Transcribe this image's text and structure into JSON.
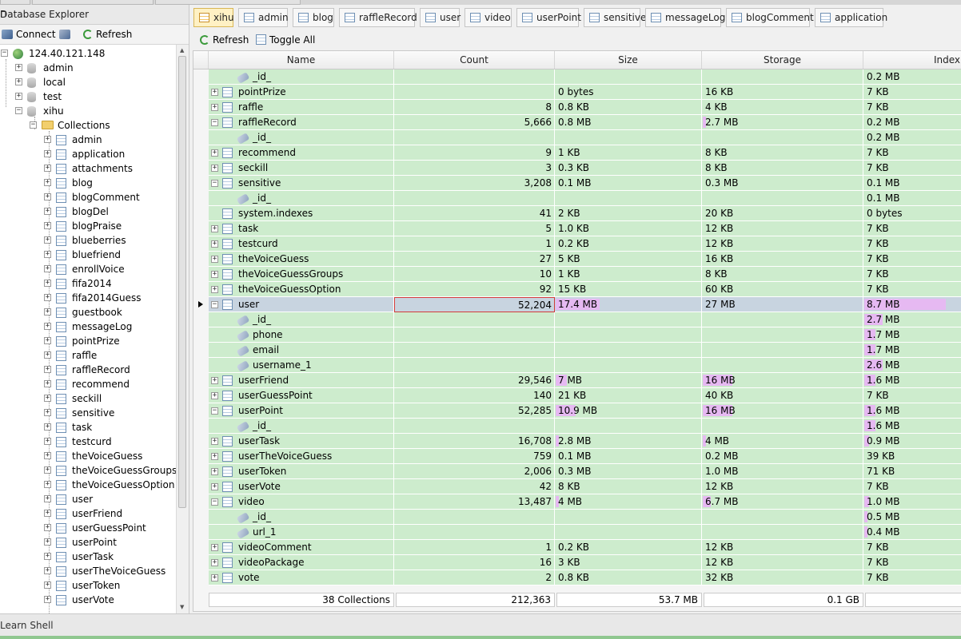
{
  "explorer": {
    "title": "Database Explorer",
    "connect_label": "Connect",
    "refresh_label": "Refresh",
    "server": "124.40.121.148",
    "databases": [
      "admin",
      "local",
      "test",
      "xihu"
    ],
    "collections_folder": "Collections",
    "collections": [
      "admin",
      "application",
      "attachments",
      "blog",
      "blogComment",
      "blogDel",
      "blogPraise",
      "blueberries",
      "bluefriend",
      "enrollVoice",
      "fifa2014",
      "fifa2014Guess",
      "guestbook",
      "messageLog",
      "pointPrize",
      "raffle",
      "raffleRecord",
      "recommend",
      "seckill",
      "sensitive",
      "task",
      "testcurd",
      "theVoiceGuess",
      "theVoiceGuessGroups",
      "theVoiceGuessOption",
      "user",
      "userFriend",
      "userGuessPoint",
      "userPoint",
      "userTask",
      "userTheVoiceGuess",
      "userToken",
      "userVote"
    ]
  },
  "tabs": [
    "xihu",
    "admin",
    "blog",
    "raffleRecord",
    "user",
    "video",
    "userPoint",
    "sensitive",
    "messageLog",
    "blogComment",
    "application"
  ],
  "toolbar": {
    "refresh_label": "Refresh",
    "toggle_label": "Toggle All"
  },
  "grid": {
    "headers": {
      "name": "Name",
      "count": "Count",
      "size": "Size",
      "storage": "Storage",
      "index": "Index"
    },
    "rows": [
      {
        "type": "index",
        "name": "_id_",
        "count": "",
        "size": "",
        "storage": "",
        "index": "0.2 MB",
        "bars": {
          "size": 0,
          "storage": 0,
          "index": 0
        }
      },
      {
        "type": "coll",
        "exp": "+",
        "name": "pointPrize",
        "count": "",
        "size": "0 bytes",
        "storage": "16 KB",
        "index": "7 KB",
        "bars": {
          "size": 0,
          "storage": 0,
          "index": 0
        }
      },
      {
        "type": "coll",
        "exp": "+",
        "name": "raffle",
        "count": "8",
        "size": "0.8 KB",
        "storage": "4 KB",
        "index": "7 KB",
        "bars": {
          "size": 0,
          "storage": 0,
          "index": 0
        }
      },
      {
        "type": "coll",
        "exp": "-",
        "name": "raffleRecord",
        "count": "5,666",
        "size": "0.8 MB",
        "storage": "2.7 MB",
        "index": "0.2 MB",
        "bars": {
          "size": 0,
          "storage": 0.02,
          "index": 0
        }
      },
      {
        "type": "index",
        "name": "_id_",
        "count": "",
        "size": "",
        "storage": "",
        "index": "0.2 MB",
        "bars": {
          "size": 0,
          "storage": 0,
          "index": 0
        }
      },
      {
        "type": "coll",
        "exp": "+",
        "name": "recommend",
        "count": "9",
        "size": "1 KB",
        "storage": "8 KB",
        "index": "7 KB",
        "bars": {
          "size": 0,
          "storage": 0,
          "index": 0
        }
      },
      {
        "type": "coll",
        "exp": "+",
        "name": "seckill",
        "count": "3",
        "size": "0.3 KB",
        "storage": "8 KB",
        "index": "7 KB",
        "bars": {
          "size": 0,
          "storage": 0,
          "index": 0
        }
      },
      {
        "type": "coll",
        "exp": "-",
        "name": "sensitive",
        "count": "3,208",
        "size": "0.1 MB",
        "storage": "0.3 MB",
        "index": "0.1 MB",
        "bars": {
          "size": 0,
          "storage": 0,
          "index": 0
        }
      },
      {
        "type": "index",
        "name": "_id_",
        "count": "",
        "size": "",
        "storage": "",
        "index": "0.1 MB",
        "bars": {
          "size": 0,
          "storage": 0,
          "index": 0
        }
      },
      {
        "type": "coll",
        "exp": "",
        "name": "system.indexes",
        "count": "41",
        "size": "2 KB",
        "storage": "20 KB",
        "index": "0 bytes",
        "bars": {
          "size": 0,
          "storage": 0,
          "index": 0
        }
      },
      {
        "type": "coll",
        "exp": "+",
        "name": "task",
        "count": "5",
        "size": "1.0 KB",
        "storage": "12 KB",
        "index": "7 KB",
        "bars": {
          "size": 0,
          "storage": 0,
          "index": 0
        }
      },
      {
        "type": "coll",
        "exp": "+",
        "name": "testcurd",
        "count": "1",
        "size": "0.2 KB",
        "storage": "12 KB",
        "index": "7 KB",
        "bars": {
          "size": 0,
          "storage": 0,
          "index": 0
        }
      },
      {
        "type": "coll",
        "exp": "+",
        "name": "theVoiceGuess",
        "count": "27",
        "size": "5 KB",
        "storage": "16 KB",
        "index": "7 KB",
        "bars": {
          "size": 0,
          "storage": 0,
          "index": 0
        }
      },
      {
        "type": "coll",
        "exp": "+",
        "name": "theVoiceGuessGroups",
        "count": "10",
        "size": "1 KB",
        "storage": "8 KB",
        "index": "7 KB",
        "bars": {
          "size": 0,
          "storage": 0,
          "index": 0
        }
      },
      {
        "type": "coll",
        "exp": "+",
        "name": "theVoiceGuessOption",
        "count": "92",
        "size": "15 KB",
        "storage": "60 KB",
        "index": "7 KB",
        "bars": {
          "size": 0,
          "storage": 0,
          "index": 0
        }
      },
      {
        "type": "coll",
        "exp": "-",
        "name": "user",
        "count": "52,204",
        "size": "17.4 MB",
        "storage": "27 MB",
        "index": "8.7 MB",
        "selected": true,
        "bars": {
          "size": 0.31,
          "storage": 0,
          "index": 0.87
        }
      },
      {
        "type": "index",
        "name": "_id_",
        "count": "",
        "size": "",
        "storage": "",
        "index": "2.7 MB",
        "bars": {
          "size": 0,
          "storage": 0,
          "index": 0.2
        }
      },
      {
        "type": "index",
        "name": "phone",
        "count": "",
        "size": "",
        "storage": "",
        "index": "1.7 MB",
        "bars": {
          "size": 0,
          "storage": 0,
          "index": 0.12
        }
      },
      {
        "type": "index",
        "name": "email",
        "count": "",
        "size": "",
        "storage": "",
        "index": "1.7 MB",
        "bars": {
          "size": 0,
          "storage": 0,
          "index": 0.12
        }
      },
      {
        "type": "index",
        "name": "username_1",
        "count": "",
        "size": "",
        "storage": "",
        "index": "2.6 MB",
        "bars": {
          "size": 0,
          "storage": 0,
          "index": 0.2
        }
      },
      {
        "type": "coll",
        "exp": "+",
        "name": "userFriend",
        "count": "29,546",
        "size": "7 MB",
        "storage": "16 MB",
        "index": "1.6 MB",
        "bars": {
          "size": 0.08,
          "storage": 0.19,
          "index": 0.12
        }
      },
      {
        "type": "coll",
        "exp": "+",
        "name": "userGuessPoint",
        "count": "140",
        "size": "21 KB",
        "storage": "40 KB",
        "index": "7 KB",
        "bars": {
          "size": 0,
          "storage": 0,
          "index": 0
        }
      },
      {
        "type": "coll",
        "exp": "-",
        "name": "userPoint",
        "count": "52,285",
        "size": "10.9 MB",
        "storage": "16 MB",
        "index": "1.6 MB",
        "bars": {
          "size": 0.14,
          "storage": 0.19,
          "index": 0.12
        }
      },
      {
        "type": "index",
        "name": "_id_",
        "count": "",
        "size": "",
        "storage": "",
        "index": "1.6 MB",
        "bars": {
          "size": 0,
          "storage": 0,
          "index": 0.12
        }
      },
      {
        "type": "coll",
        "exp": "+",
        "name": "userTask",
        "count": "16,708",
        "size": "2.8 MB",
        "storage": "4 MB",
        "index": "0.9 MB",
        "bars": {
          "size": 0.02,
          "storage": 0.02,
          "index": 0.05
        }
      },
      {
        "type": "coll",
        "exp": "+",
        "name": "userTheVoiceGuess",
        "count": "759",
        "size": "0.1 MB",
        "storage": "0.2 MB",
        "index": "39 KB",
        "bars": {
          "size": 0,
          "storage": 0,
          "index": 0
        }
      },
      {
        "type": "coll",
        "exp": "+",
        "name": "userToken",
        "count": "2,006",
        "size": "0.3 MB",
        "storage": "1.0 MB",
        "index": "71 KB",
        "bars": {
          "size": 0,
          "storage": 0,
          "index": 0
        }
      },
      {
        "type": "coll",
        "exp": "+",
        "name": "userVote",
        "count": "42",
        "size": "8 KB",
        "storage": "12 KB",
        "index": "7 KB",
        "bars": {
          "size": 0,
          "storage": 0,
          "index": 0
        }
      },
      {
        "type": "coll",
        "exp": "-",
        "name": "video",
        "count": "13,487",
        "size": "4 MB",
        "storage": "6.7 MB",
        "index": "1.0 MB",
        "bars": {
          "size": 0.02,
          "storage": 0.05,
          "index": 0.05
        }
      },
      {
        "type": "index",
        "name": "_id_",
        "count": "",
        "size": "",
        "storage": "",
        "index": "0.5 MB",
        "bars": {
          "size": 0,
          "storage": 0,
          "index": 0.02
        }
      },
      {
        "type": "index",
        "name": "url_1",
        "count": "",
        "size": "",
        "storage": "",
        "index": "0.4 MB",
        "bars": {
          "size": 0,
          "storage": 0,
          "index": 0.02
        }
      },
      {
        "type": "coll",
        "exp": "+",
        "name": "videoComment",
        "count": "1",
        "size": "0.2 KB",
        "storage": "12 KB",
        "index": "7 KB",
        "bars": {
          "size": 0,
          "storage": 0,
          "index": 0
        }
      },
      {
        "type": "coll",
        "exp": "+",
        "name": "videoPackage",
        "count": "16",
        "size": "3 KB",
        "storage": "12 KB",
        "index": "7 KB",
        "bars": {
          "size": 0,
          "storage": 0,
          "index": 0
        }
      },
      {
        "type": "coll",
        "exp": "+",
        "name": "vote",
        "count": "2",
        "size": "0.8 KB",
        "storage": "32 KB",
        "index": "7 KB",
        "bars": {
          "size": 0,
          "storage": 0,
          "index": 0
        }
      }
    ],
    "footer": {
      "collections": "38 Collections",
      "count": "212,363",
      "size": "53.7 MB",
      "storage": "0.1 GB"
    }
  },
  "status": {
    "text": "Learn Shell"
  },
  "colors": {
    "row_bg": "#cdeccd",
    "selected_bg": "#c8d4e0",
    "bar": "#e6b9f2",
    "active_tab": "#fff1c4"
  }
}
